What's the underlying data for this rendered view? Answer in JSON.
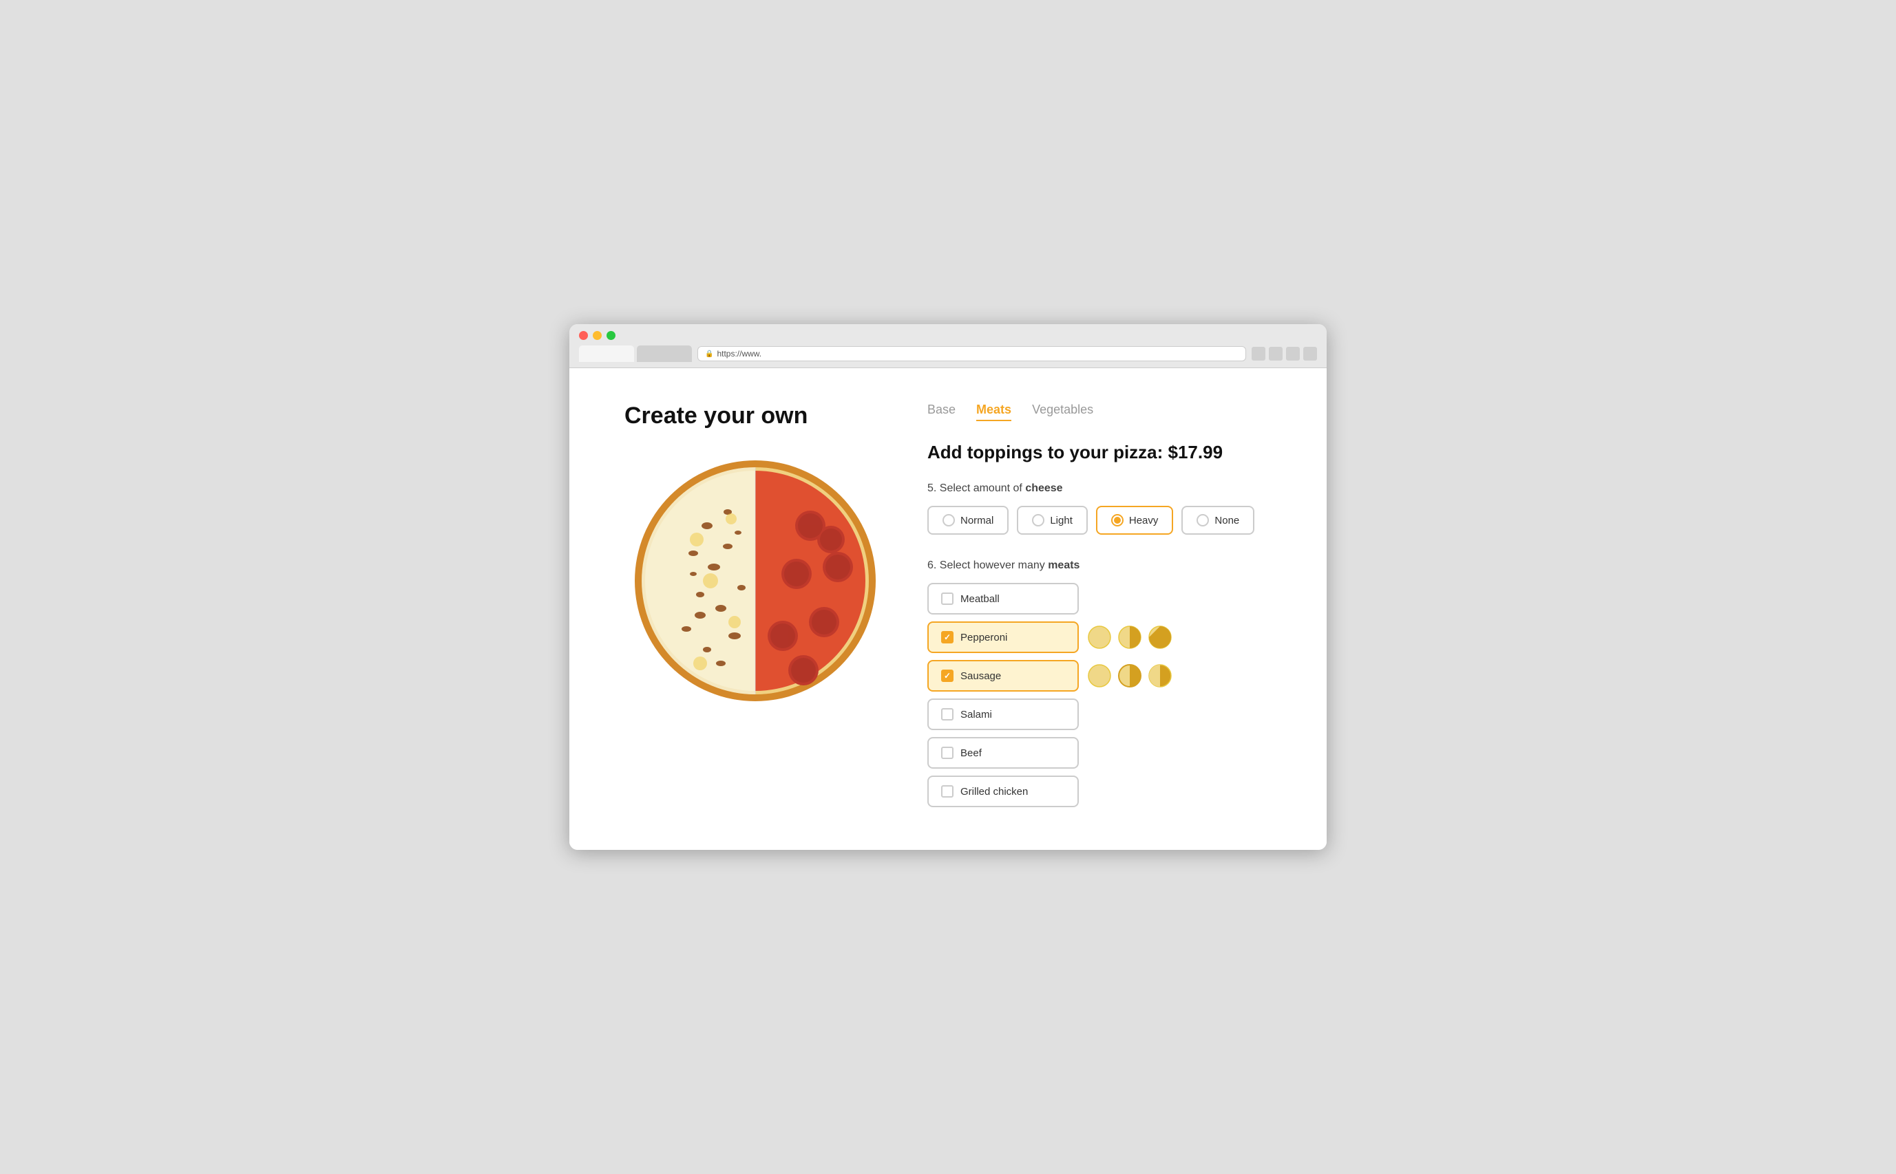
{
  "browser": {
    "url": "https://www."
  },
  "page": {
    "title": "Create your own"
  },
  "tabs": [
    {
      "label": "Base",
      "active": false
    },
    {
      "label": "Meats",
      "active": true
    },
    {
      "label": "Vegetables",
      "active": false
    }
  ],
  "section_title": "Add toppings to your pizza: $17.99",
  "cheese_section": {
    "label_prefix": "5. Select amount of ",
    "label_bold": "cheese",
    "options": [
      {
        "label": "Normal",
        "selected": false
      },
      {
        "label": "Light",
        "selected": false
      },
      {
        "label": "Heavy",
        "selected": true
      },
      {
        "label": "None",
        "selected": false
      }
    ]
  },
  "meat_section": {
    "label_prefix": "6. Select however many ",
    "label_bold": "meats",
    "items": [
      {
        "label": "Meatball",
        "checked": false,
        "has_portions": false
      },
      {
        "label": "Pepperoni",
        "checked": true,
        "has_portions": true
      },
      {
        "label": "Sausage",
        "checked": true,
        "has_portions": true
      },
      {
        "label": "Salami",
        "checked": false,
        "has_portions": false
      },
      {
        "label": "Beef",
        "checked": false,
        "has_portions": false
      },
      {
        "label": "Grilled chicken",
        "checked": false,
        "has_portions": false
      }
    ]
  },
  "colors": {
    "accent": "#f5a623",
    "accent_bg": "#fef3d0"
  }
}
